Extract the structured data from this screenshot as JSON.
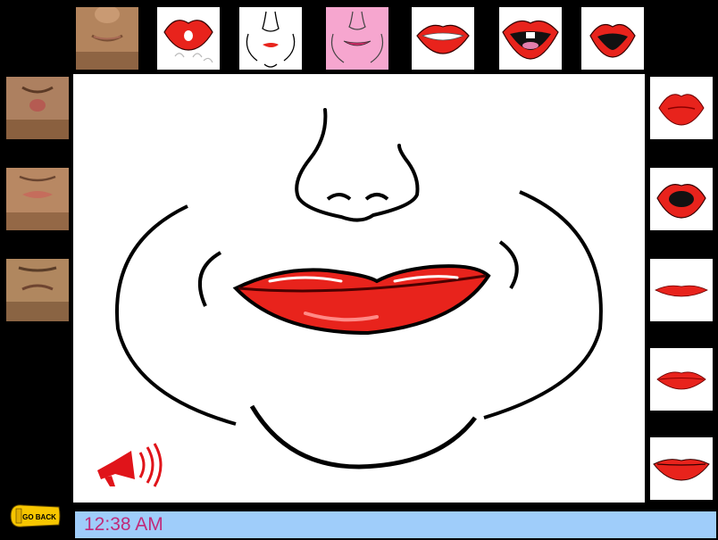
{
  "top_row": [
    {
      "name": "thumb-face-smile",
      "kind": "photo"
    },
    {
      "name": "thumb-lips-kiss-blow",
      "kind": "cartoon"
    },
    {
      "name": "thumb-face-outline-smirk",
      "kind": "cartoon"
    },
    {
      "name": "thumb-face-pink-smile",
      "kind": "cartoon"
    },
    {
      "name": "thumb-lips-teeth-smile",
      "kind": "cartoon"
    },
    {
      "name": "thumb-lips-open-tongue",
      "kind": "cartoon"
    },
    {
      "name": "thumb-lips-open-o",
      "kind": "cartoon"
    }
  ],
  "left_column": [
    {
      "name": "thumb-face-pucker"
    },
    {
      "name": "thumb-face-lips-closed"
    },
    {
      "name": "thumb-face-frown"
    }
  ],
  "right_column": [
    {
      "name": "thumb-lips-pucker"
    },
    {
      "name": "thumb-lips-oh"
    },
    {
      "name": "thumb-lips-thin"
    },
    {
      "name": "thumb-lips-closed"
    },
    {
      "name": "thumb-lips-grin"
    }
  ],
  "go_back": {
    "label": "GO BACK"
  },
  "status_bar": {
    "time": "12:38 AM"
  },
  "colors": {
    "lip_red": "#e8231c",
    "skin": "#b88a64",
    "pink_bg": "#f6a6cf",
    "status_bg": "#9fcdfa",
    "time_text": "#c02b7a",
    "speaker_red": "#e0141a",
    "go_back_yellow": "#f7c600"
  }
}
